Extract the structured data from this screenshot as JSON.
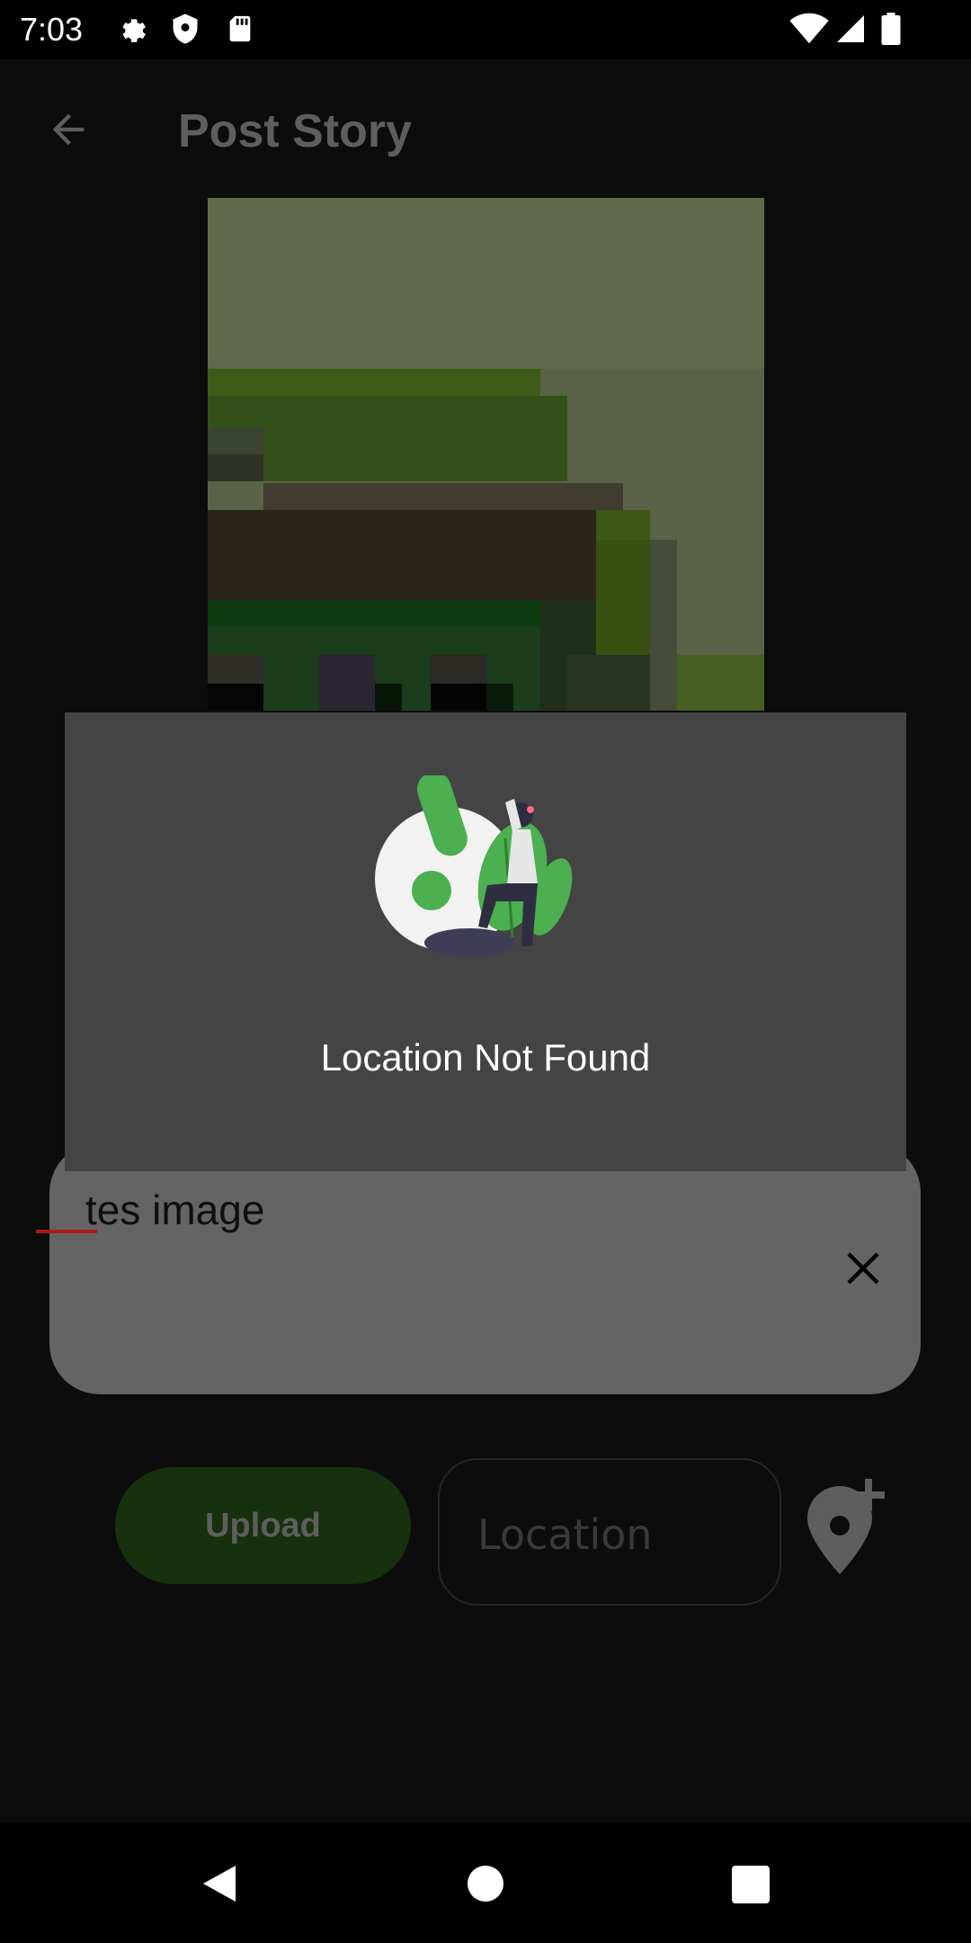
{
  "status_bar": {
    "time": "7:03",
    "icons": [
      "gear-icon",
      "shield-icon",
      "sd-card-icon",
      "wifi-icon",
      "signal-icon",
      "battery-icon"
    ]
  },
  "app_bar": {
    "title": "Post Story",
    "back_icon": "arrow-left-icon"
  },
  "form": {
    "caption_value": "tes image",
    "clear_icon": "close-icon",
    "upload_label": "Upload",
    "location_placeholder": "Location",
    "add_location_icon": "add-location-icon"
  },
  "dialog": {
    "message": "Location Not Found",
    "accent_color": "#4caf50"
  },
  "nav_bar": {
    "buttons": [
      "back-triangle-icon",
      "home-circle-icon",
      "recents-square-icon"
    ]
  },
  "colors": {
    "overlay_background": "#0c0c0c",
    "dialog_background": "#444444",
    "upload_button": "#17300e"
  }
}
